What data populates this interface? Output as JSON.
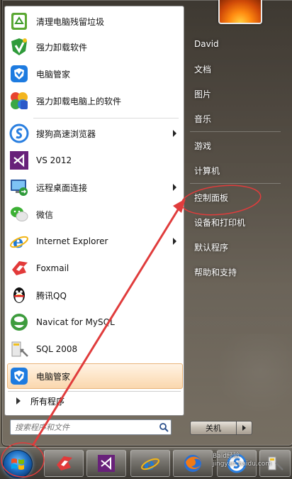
{
  "start_menu": {
    "programs": [
      {
        "label": "清理电脑残留垃圾",
        "icon": "recycle-bin-icon"
      },
      {
        "label": "强力卸载软件",
        "icon": "uninstall-shield-icon"
      },
      {
        "label": "电脑管家",
        "icon": "pc-manager-icon"
      },
      {
        "label": "强力卸载电脑上的软件",
        "icon": "uninstall-pinwheel-icon"
      },
      {
        "label": "搜狗高速浏览器",
        "icon": "sogou-browser-icon",
        "submenu": true
      },
      {
        "label": "VS 2012",
        "icon": "visual-studio-icon"
      },
      {
        "label": "远程桌面连接",
        "icon": "remote-desktop-icon",
        "submenu": true
      },
      {
        "label": "微信",
        "icon": "wechat-icon"
      },
      {
        "label": "Internet Explorer",
        "icon": "internet-explorer-icon",
        "submenu": true
      },
      {
        "label": "Foxmail",
        "icon": "foxmail-icon"
      },
      {
        "label": "腾讯QQ",
        "icon": "qq-penguin-icon"
      },
      {
        "label": "Navicat for MySQL",
        "icon": "navicat-icon"
      },
      {
        "label": "SQL 2008",
        "icon": "sql-server-icon"
      },
      {
        "label": "电脑管家",
        "icon": "pc-manager-icon",
        "highlighted": true
      }
    ],
    "all_programs_label": "所有程序",
    "search_placeholder": "搜索程序和文件",
    "right_items": [
      "David",
      "文档",
      "图片",
      "音乐",
      "游戏",
      "计算机",
      "控制面板",
      "设备和打印机",
      "默认程序",
      "帮助和支持"
    ],
    "shutdown_label": "关机"
  },
  "taskbar": {
    "apps": [
      "foxmail-icon",
      "visual-studio-icon",
      "internet-explorer-icon",
      "firefox-icon",
      "sogou-browser-icon"
    ]
  },
  "watermark": {
    "line1": "Baid经验",
    "line2": "jingyan.baidu.com"
  },
  "colors": {
    "annotation_red": "#e03c3c",
    "highlight": "#fad7ae"
  }
}
